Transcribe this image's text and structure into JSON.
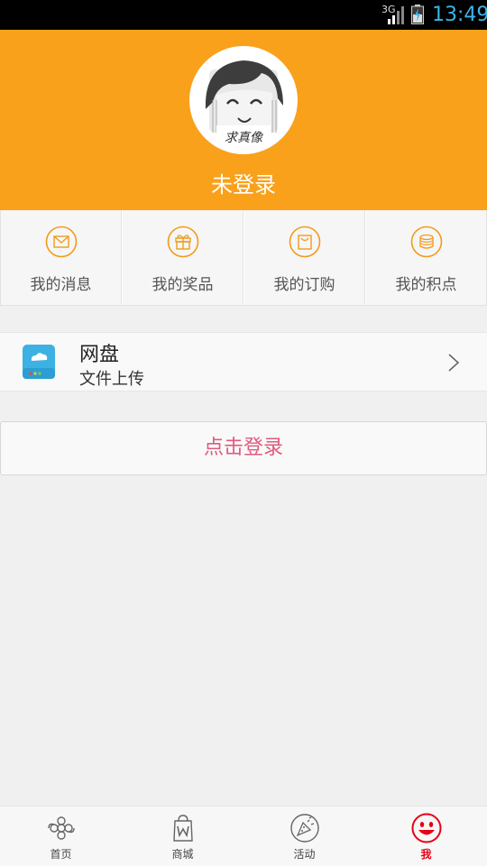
{
  "status_bar": {
    "network": "3G",
    "time": "13:49",
    "icons": [
      "signal-icon",
      "battery-charging-icon"
    ]
  },
  "header": {
    "avatar_caption": "求真像",
    "login_status": "未登录",
    "background_color": "#f9a11b"
  },
  "quick_menu": [
    {
      "label": "我的消息",
      "icon": "envelope-icon"
    },
    {
      "label": "我的奖品",
      "icon": "gift-icon"
    },
    {
      "label": "我的订购",
      "icon": "shopping-bag-icon"
    },
    {
      "label": "我的积点",
      "icon": "coins-icon"
    }
  ],
  "cloud_disk": {
    "title": "网盘",
    "subtitle": "文件上传",
    "icon": "cloud-drive-icon"
  },
  "login_button": {
    "label": "点击登录",
    "color": "#e05a7e"
  },
  "bottom_nav": {
    "items": [
      {
        "label": "首页",
        "icon": "unicom-knot-icon"
      },
      {
        "label": "商城",
        "icon": "shopping-bag-w-icon"
      },
      {
        "label": "活动",
        "icon": "party-icon"
      },
      {
        "label": "我",
        "icon": "smiley-icon",
        "active": true
      }
    ],
    "active_color": "#e50014"
  }
}
